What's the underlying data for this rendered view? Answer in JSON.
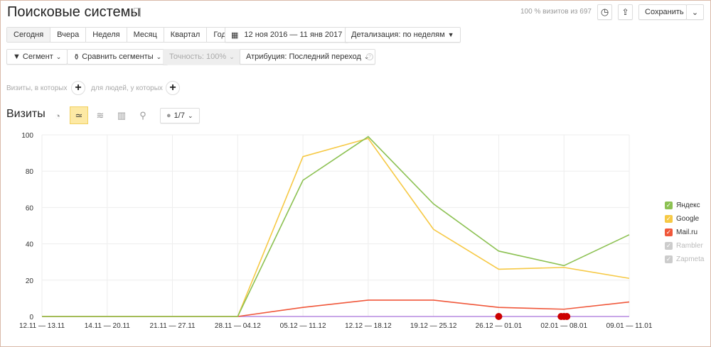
{
  "header": {
    "title": "Поисковые системы",
    "visits_info": "100 % визитов из 697",
    "save_label": "Сохранить"
  },
  "periods": [
    {
      "label": "Сегодня"
    },
    {
      "label": "Вчера"
    },
    {
      "label": "Неделя"
    },
    {
      "label": "Месяц"
    },
    {
      "label": "Квартал"
    },
    {
      "label": "Год"
    }
  ],
  "date_range": "12 ноя 2016 — 11 янв 2017",
  "detail": "Детализация: по неделям",
  "filters": {
    "segment": "Сегмент",
    "compare": "Сравнить сегменты",
    "accuracy": "Точность: 100%",
    "attribution": "Атрибуция: Последний переход"
  },
  "conditions": {
    "visits": "Визиты, в которых",
    "people": "для людей, у которых"
  },
  "chart_header": {
    "title": "Визиты",
    "annotations": "1/7"
  },
  "chart_data": {
    "type": "line",
    "categories": [
      "12.11 — 13.11",
      "14.11 — 20.11",
      "21.11 — 27.11",
      "28.11 — 04.12",
      "05.12 — 11.12",
      "12.12 — 18.12",
      "19.12 — 25.12",
      "26.12 — 01.01",
      "02.01 — 08.01",
      "09.01 — 11.01"
    ],
    "ylim": [
      0,
      100
    ],
    "yticks": [
      "0",
      "20",
      "40",
      "60",
      "80",
      "100"
    ],
    "series": [
      {
        "name": "Яндекс",
        "color": "#8cc152",
        "enabled": true,
        "values": [
          0,
          0,
          0,
          0,
          75,
          99,
          62,
          36,
          28,
          45
        ]
      },
      {
        "name": "Google",
        "color": "#f6c945",
        "enabled": true,
        "values": [
          0,
          0,
          0,
          0,
          88,
          98,
          48,
          26,
          27,
          21
        ]
      },
      {
        "name": "Mail.ru",
        "color": "#f0573a",
        "enabled": true,
        "values": [
          0,
          0,
          0,
          0,
          5,
          9,
          9,
          5,
          4,
          8
        ]
      },
      {
        "name": "Rambler",
        "color": "#cccccc",
        "enabled": false,
        "values": [
          0,
          0,
          0,
          0,
          0,
          0,
          0,
          0,
          0,
          0
        ]
      },
      {
        "name": "Zapmeta",
        "color": "#cccccc",
        "enabled": false,
        "values": [
          0,
          0,
          0,
          0,
          0,
          0,
          0,
          0,
          0,
          0
        ]
      }
    ],
    "legend": "right"
  }
}
